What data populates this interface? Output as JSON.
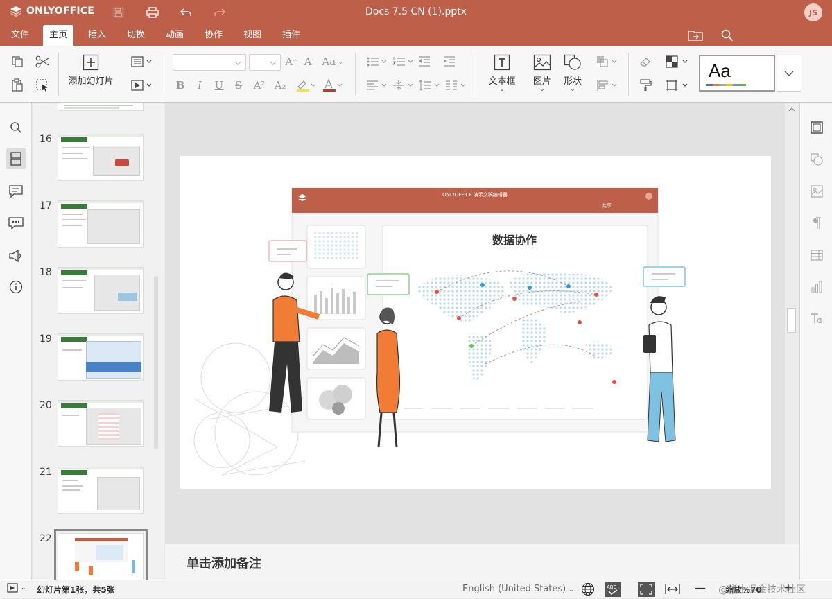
{
  "app": {
    "logo_text": "ONLYOFFICE",
    "document_title": "Docs 7.5 CN (1).pptx",
    "user_initials": "JS",
    "accent_color": "#be6049"
  },
  "quick_access": [
    {
      "icon": "save-icon"
    },
    {
      "icon": "print-icon"
    },
    {
      "icon": "undo-icon"
    },
    {
      "icon": "redo-icon"
    }
  ],
  "menu": {
    "tabs": [
      {
        "label": "文件"
      },
      {
        "label": "主页"
      },
      {
        "label": "插入"
      },
      {
        "label": "切换"
      },
      {
        "label": "动画"
      },
      {
        "label": "协作"
      },
      {
        "label": "视图"
      },
      {
        "label": "插件"
      }
    ],
    "active_tab": "主页"
  },
  "toolbar": {
    "add_slide_label": "添加幻灯片",
    "textbox_label": "文本框",
    "image_label": "图片",
    "shape_label": "形状",
    "theme_preview": "Aa",
    "font_size_up": "A",
    "font_size_down": "A",
    "change_case": "Aa",
    "bold": "B",
    "italic": "I",
    "underline": "U",
    "strike": "S",
    "superscript": "A²",
    "subscript": "A₂"
  },
  "slide_thumbnails": [
    {
      "number": "16"
    },
    {
      "number": "17"
    },
    {
      "number": "18"
    },
    {
      "number": "19"
    },
    {
      "number": "20"
    },
    {
      "number": "21"
    },
    {
      "number": "22"
    }
  ],
  "slide": {
    "inner_app_title": "ONLYOFFICE 演示文稿编辑器",
    "share_label": "共享",
    "main_heading": "数据协作"
  },
  "notes_placeholder": "单击添加备注",
  "status": {
    "slide_info": "幻灯片第1张，共5张",
    "language": "English (United States)",
    "zoom_label": "缩放%70",
    "watermark": "@稀土掘金技术社区"
  }
}
